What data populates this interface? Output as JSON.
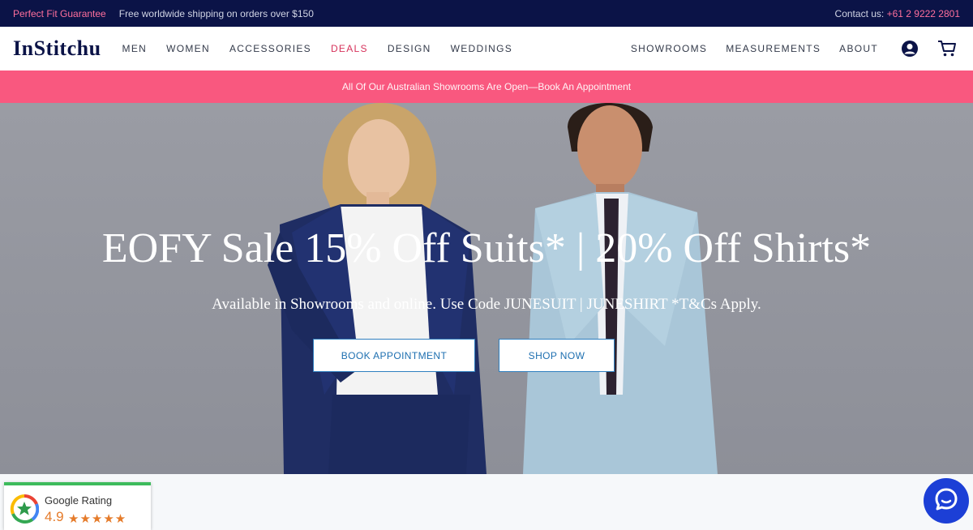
{
  "topbar": {
    "promo": "Perfect Fit Guarantee",
    "shipping": "Free worldwide shipping on orders over $150",
    "contact_label": "Contact us: ",
    "phone": "+61 2 9222 2801"
  },
  "nav": {
    "logo": "InStitchu",
    "items": [
      "MEN",
      "WOMEN",
      "ACCESSORIES",
      "DEALS",
      "DESIGN",
      "WEDDINGS"
    ],
    "right_items": [
      "SHOWROOMS",
      "MEASUREMENTS",
      "ABOUT"
    ],
    "icons": [
      "account-icon",
      "cart-icon"
    ]
  },
  "announcement": "All Of Our Australian Showrooms Are Open—Book An Appointment",
  "hero": {
    "title": "EOFY Sale 15% Off Suits* | 20% Off Shirts*",
    "subtitle": "Available in Showrooms and online. Use Code JUNESUIT | JUNESHIRT *T&Cs Apply.",
    "book_button": "BOOK APPOINTMENT",
    "shop_button": "SHOP NOW"
  },
  "rating_widget": {
    "label": "Google Rating",
    "score": "4.9",
    "stars": "★★★★★",
    "icon": "google-g-icon"
  },
  "chat": {
    "icon": "chat-bubble-icon",
    "color": "#1c3fd6"
  },
  "colors": {
    "navy": "#0b1347",
    "pink": "#f9587f",
    "accent_red": "#d6315a",
    "button_blue": "#1d6fb0"
  }
}
